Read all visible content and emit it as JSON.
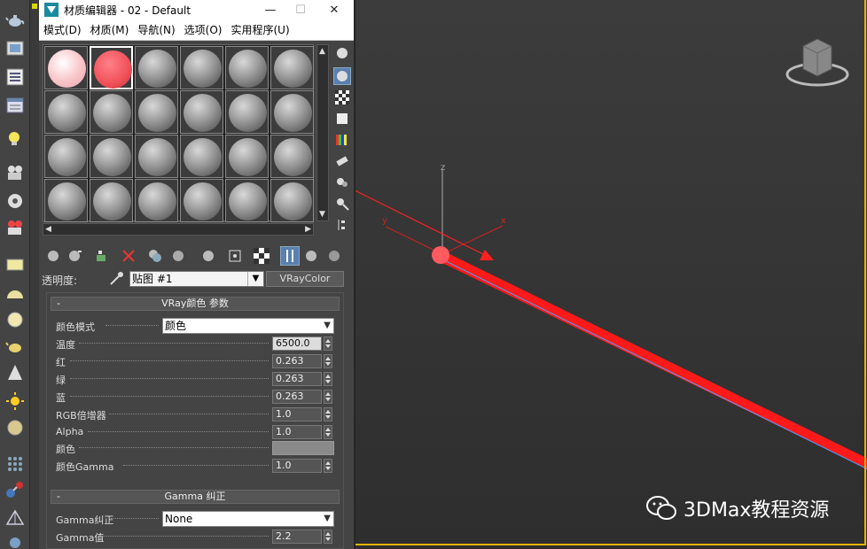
{
  "window": {
    "title": "材质编辑器 - 02 - Default",
    "min_label": "—",
    "max_label": "☐",
    "close_label": "✕"
  },
  "menu": [
    "模式(D)",
    "材质(M)",
    "导航(N)",
    "选项(O)",
    "实用程序(U)"
  ],
  "slots": {
    "rows": 4,
    "cols": 6,
    "slot1_color": "#f8c4c8",
    "slot2_color": "#f05058",
    "default_color": "#a0a0a0"
  },
  "name_row": {
    "label": "透明度:",
    "map_name": "贴图 #1",
    "type_button": "VRayColor"
  },
  "rollout1": {
    "title": "VRay颜色 参数",
    "color_mode_label": "颜色模式",
    "color_mode_value": "颜色",
    "params": [
      {
        "label": "温度",
        "value": "6500.0",
        "light": true
      },
      {
        "label": "红",
        "value": "0.263",
        "light": false
      },
      {
        "label": "绿",
        "value": "0.263",
        "light": false
      },
      {
        "label": "蓝",
        "value": "0.263",
        "light": false
      },
      {
        "label": "RGB倍增器",
        "value": "1.0",
        "light": false
      },
      {
        "label": "Alpha",
        "value": "1.0",
        "light": false
      }
    ],
    "color_label": "颜色",
    "color_gamma_label": "颜色Gamma",
    "color_gamma_value": "1.0"
  },
  "rollout2": {
    "title": "Gamma 纠正",
    "gamma_correct_label": "Gamma纠正",
    "gamma_correct_value": "None",
    "gamma_value_label": "Gamma值",
    "gamma_value": "2.2"
  },
  "viewport": {
    "axis_x": "x",
    "axis_y": "y",
    "axis_z": "z",
    "beam_color": "#ff1a1a",
    "frame_color": "#e8b400"
  },
  "watermark": {
    "text": "3DMax教程资源"
  },
  "icons": {
    "teapot": "teapot-icon",
    "render": "render-icon",
    "light": "light-icon",
    "camera": "camera-icon",
    "sun": "sun-icon"
  }
}
